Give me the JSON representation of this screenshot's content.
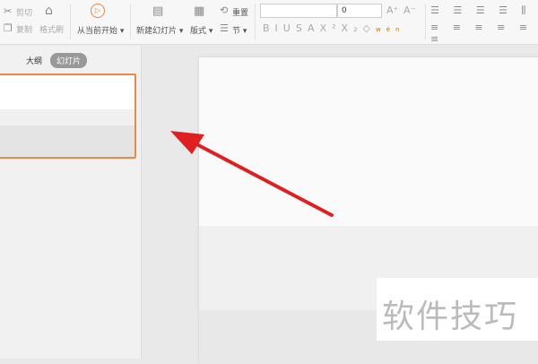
{
  "toolbar": {
    "cut": "剪切",
    "copy": "复制",
    "format_painter": "格式刷",
    "play_from_current": "从当前开始",
    "new_slide": "新建幻灯片",
    "layout": "版式",
    "reset": "重置",
    "section": "节",
    "font_name": "",
    "font_size": "0",
    "format_buttons": [
      "B",
      "I",
      "U",
      "S",
      "A",
      "X²",
      "X₂",
      "◇",
      "wén"
    ]
  },
  "left_pane": {
    "tabs": [
      "大纲",
      "幻灯片"
    ],
    "active_tab": 1
  },
  "watermark": "软件技巧",
  "colors": {
    "accent": "#e8884a",
    "arrow": "#e02020"
  }
}
